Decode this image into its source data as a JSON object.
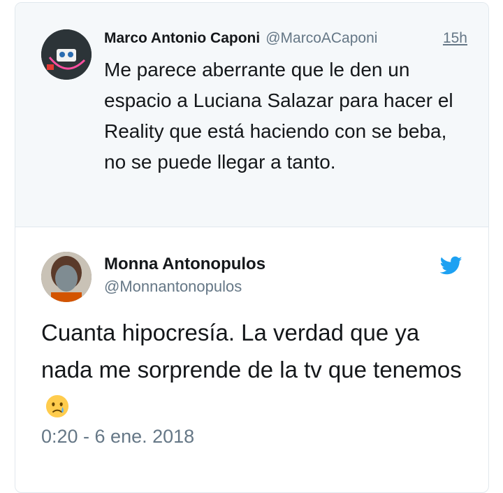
{
  "parent_tweet": {
    "display_name": "Marco Antonio Caponi",
    "handle": "@MarcoACaponi",
    "time": "15h",
    "text": "Me parece aberrante que le den un espacio a Luciana Salazar para hacer el Reality que está haciendo con se beba, no se puede llegar a tanto."
  },
  "reply_tweet": {
    "display_name": "Monna Antonopulos",
    "handle": "@Monnantonopulos",
    "text": "Cuanta hipocresía. La verdad que ya nada me sorprende de la tv que tenemos",
    "emoji": "crying-face",
    "timestamp": "0:20 - 6 ene. 2018"
  },
  "icons": {
    "brand": "twitter-bird-icon",
    "brand_color": "#1da1f2"
  },
  "colors": {
    "parent_background": "#f5f8fa",
    "secondary_text": "#657786",
    "primary_text": "#14171a",
    "border": "#e1e8ed"
  }
}
